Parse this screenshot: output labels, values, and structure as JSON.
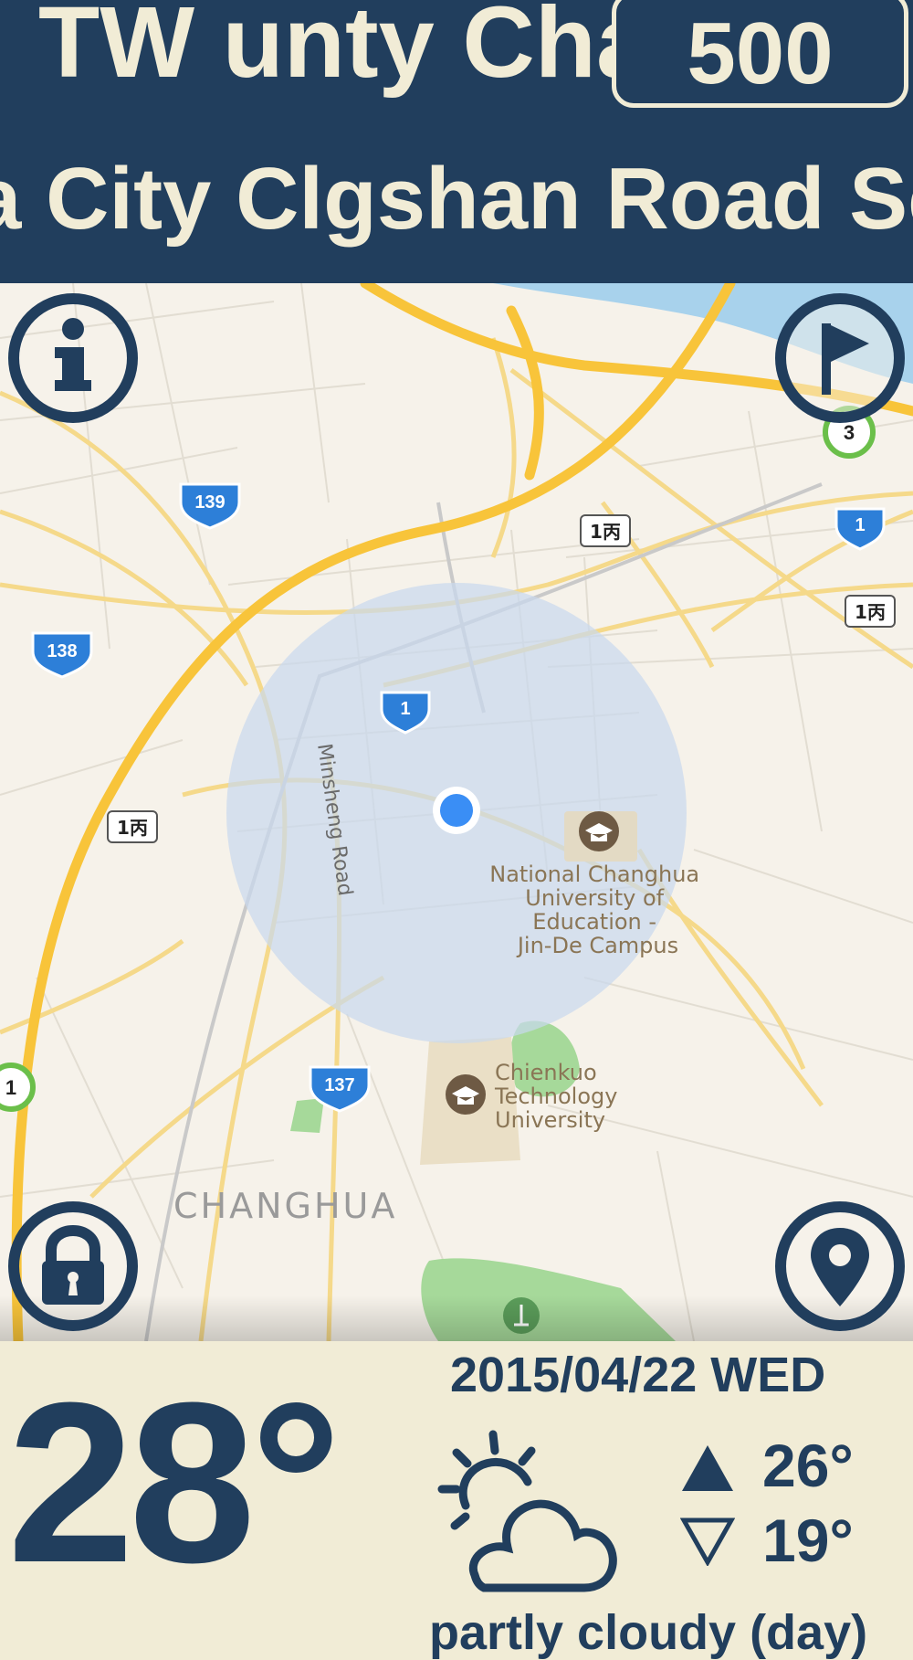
{
  "header": {
    "county_text": "TW  unty Cha",
    "speed_value": "500",
    "road_text": "a City Clgshan Road Se"
  },
  "map": {
    "road_shields": [
      "139",
      "138",
      "137",
      "1",
      "1",
      "1丙",
      "1丙",
      "1丙",
      "3",
      "1"
    ],
    "labels": {
      "minsheng_road": "Minsheng Road",
      "ncue": [
        "National Changhua",
        "University of",
        "Education -",
        "Jin-De Campus"
      ],
      "chienkuo": [
        "Chienkuo",
        "Technology",
        "University"
      ],
      "city": "CHANGHUA"
    },
    "buttons": {
      "info": "info-icon",
      "flag": "flag-icon",
      "lock": "lock-icon",
      "location": "location-pin-icon"
    }
  },
  "weather": {
    "temperature": "28°",
    "date": "2015/04/22 WED",
    "high": "26°",
    "low": "19°",
    "condition": "partly cloudy (day)",
    "icon": "partly-cloudy-day-icon"
  },
  "colors": {
    "navy": "#213e5d",
    "cream": "#f1ecd6",
    "highway": "#f8c43a",
    "road": "#f5d98a",
    "water": "#a8d2ec",
    "park": "#a6d99a",
    "accuracy_circle": "#c9d8ee",
    "location_dot": "#3a8ef5"
  }
}
